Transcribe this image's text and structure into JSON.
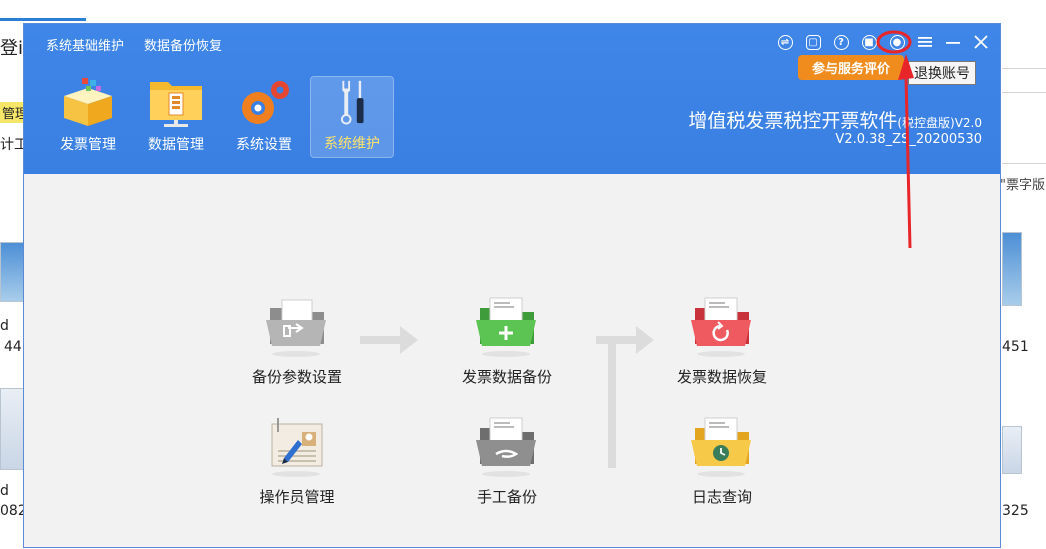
{
  "background": {
    "left_texts": [
      "登i",
      "管理",
      "计工",
      "d",
      "44",
      "d",
      "082"
    ],
    "right_texts": [
      "\"票字版",
      "451",
      "325"
    ]
  },
  "menu": [
    "系统基础维护",
    "数据备份恢复"
  ],
  "nav": [
    {
      "label": "发票管理",
      "icon": "invoice-box-icon"
    },
    {
      "label": "数据管理",
      "icon": "data-folder-icon"
    },
    {
      "label": "系统设置",
      "icon": "gears-icon"
    },
    {
      "label": "系统维护",
      "icon": "tools-icon",
      "active": true
    }
  ],
  "app": {
    "title": "增值税发票税控开票软件",
    "title_suffix": "(税控盘版)V2.0",
    "version": "V2.0.38_ZS_20200530"
  },
  "tooltips": {
    "evaluate": "参与服务评价",
    "logout": "退换账号"
  },
  "operations": [
    {
      "label": "备份参数设置",
      "icon": "backup-settings-icon"
    },
    {
      "label": "发票数据备份",
      "icon": "invoice-backup-icon"
    },
    {
      "label": "发票数据恢复",
      "icon": "invoice-restore-icon"
    },
    {
      "label": "操作员管理",
      "icon": "operator-management-icon"
    },
    {
      "label": "手工备份",
      "icon": "manual-backup-icon"
    },
    {
      "label": "日志查询",
      "icon": "log-query-icon"
    }
  ],
  "colors": {
    "header": "#3a7fe2",
    "accent_orange": "#f08c1e",
    "annotation_red": "#e8262a",
    "active_label": "#ffe36a"
  }
}
